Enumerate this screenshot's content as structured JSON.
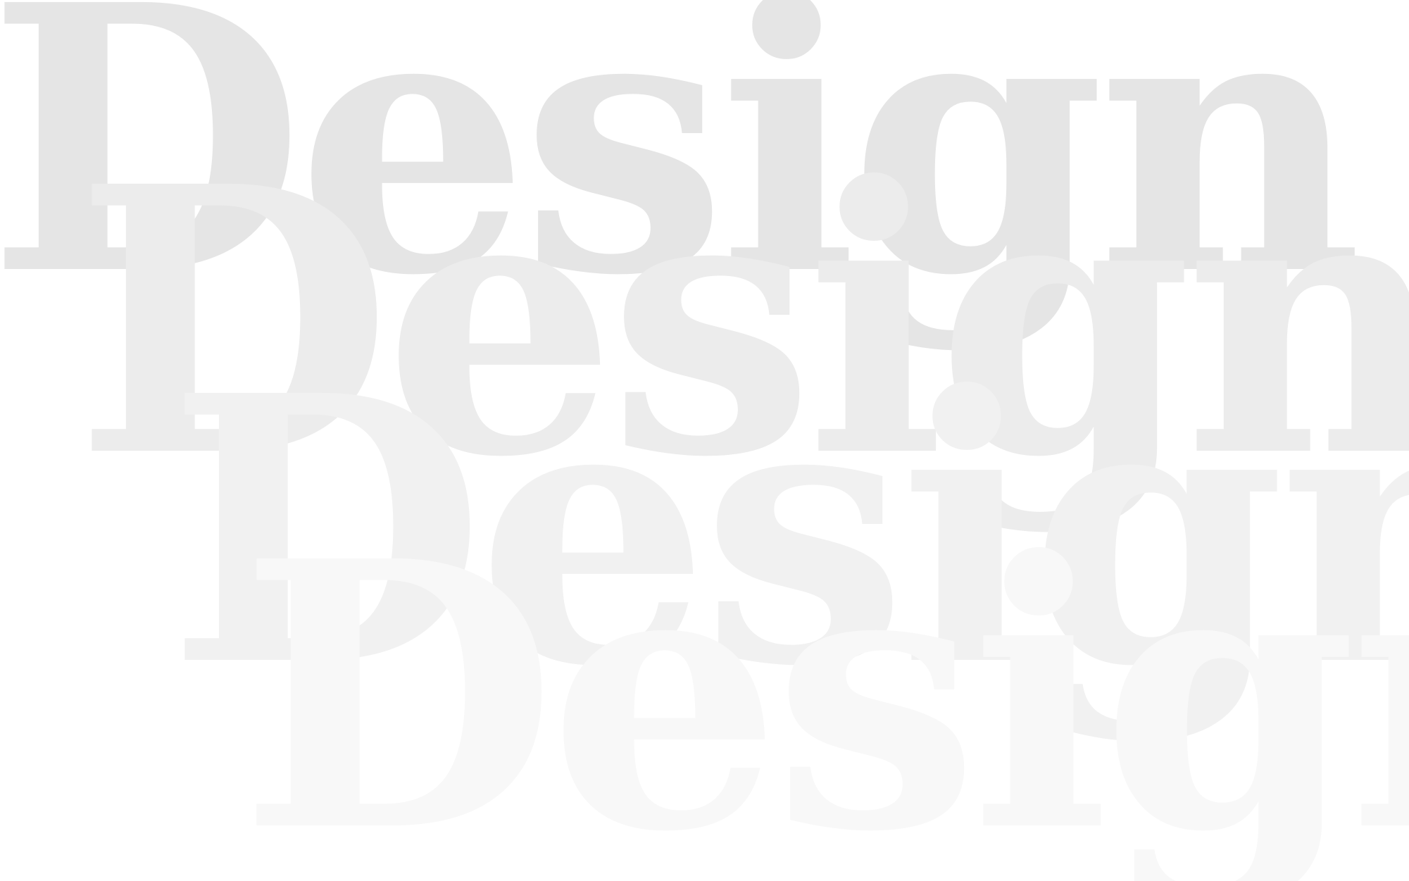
{
  "artwork": {
    "layers": [
      {
        "text": "Design",
        "color": "#e5e5e5"
      },
      {
        "text": "Design",
        "color": "#ececec"
      },
      {
        "text": "Design",
        "color": "#f1f1f1"
      },
      {
        "text": "Design",
        "color": "#f8f8f8"
      }
    ]
  }
}
